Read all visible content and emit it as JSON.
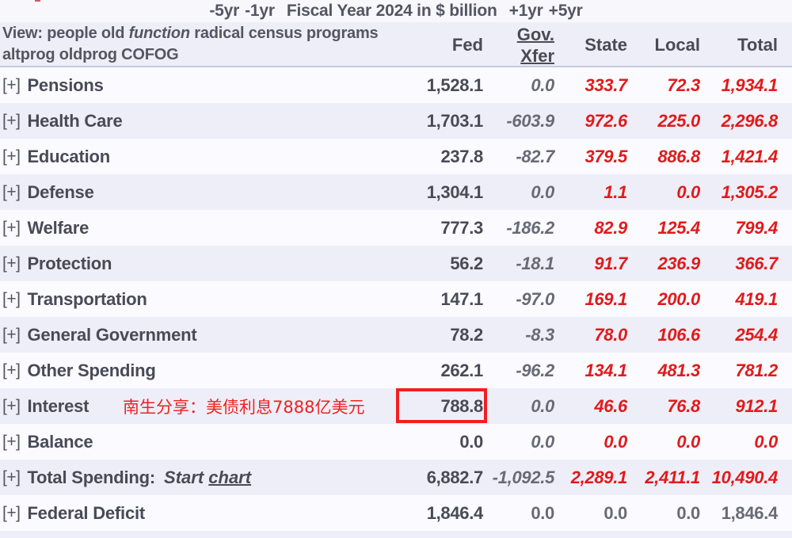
{
  "yearbar": {
    "back5": "-5yr",
    "back1": "-1yr",
    "title": "Fiscal Year 2024 in $ billion",
    "fwd1": "+1yr",
    "fwd5": "+5yr"
  },
  "view": {
    "label": "View:",
    "options": [
      "people",
      "old",
      "function",
      "radical",
      "census",
      "programs",
      "altprog",
      "oldprog",
      "COFOG"
    ],
    "selected": "function",
    "line1": "View: people old function radical census",
    "line2": "programs altprog oldprog COFOG"
  },
  "columns": [
    {
      "key": "fed",
      "label": "Fed",
      "label2": "",
      "underline": false
    },
    {
      "key": "xfer",
      "label": "Gov.",
      "label2": "Xfer",
      "underline": true
    },
    {
      "key": "state",
      "label": "State",
      "label2": "",
      "underline": false
    },
    {
      "key": "local",
      "label": "Local",
      "label2": "",
      "underline": false
    },
    {
      "key": "total",
      "label": "Total",
      "label2": "",
      "underline": false
    }
  ],
  "expander": "[+]",
  "rows": [
    {
      "name": "Pensions",
      "fed": "1,528.1",
      "xfer": "0.0",
      "state": "333.7",
      "local": "72.3",
      "total": "1,934.1",
      "style": "red"
    },
    {
      "name": "Health Care",
      "fed": "1,703.1",
      "xfer": "-603.9",
      "state": "972.6",
      "local": "225.0",
      "total": "2,296.8",
      "style": "red"
    },
    {
      "name": "Education",
      "fed": "237.8",
      "xfer": "-82.7",
      "state": "379.5",
      "local": "886.8",
      "total": "1,421.4",
      "style": "red"
    },
    {
      "name": "Defense",
      "fed": "1,304.1",
      "xfer": "0.0",
      "state": "1.1",
      "local": "0.0",
      "total": "1,305.2",
      "style": "red"
    },
    {
      "name": "Welfare",
      "fed": "777.3",
      "xfer": "-186.2",
      "state": "82.9",
      "local": "125.4",
      "total": "799.4",
      "style": "red"
    },
    {
      "name": "Protection",
      "fed": "56.2",
      "xfer": "-18.1",
      "state": "91.7",
      "local": "236.9",
      "total": "366.7",
      "style": "red"
    },
    {
      "name": "Transportation",
      "fed": "147.1",
      "xfer": "-97.0",
      "state": "169.1",
      "local": "200.0",
      "total": "419.1",
      "style": "red"
    },
    {
      "name": "General Government",
      "fed": "78.2",
      "xfer": "-8.3",
      "state": "78.0",
      "local": "106.6",
      "total": "254.4",
      "style": "red"
    },
    {
      "name": "Other Spending",
      "fed": "262.1",
      "xfer": "-96.2",
      "state": "134.1",
      "local": "481.3",
      "total": "781.2",
      "style": "red"
    },
    {
      "name": "Interest",
      "fed": "788.8",
      "xfer": "0.0",
      "state": "46.6",
      "local": "76.8",
      "total": "912.1",
      "style": "red"
    },
    {
      "name": "Balance",
      "fed": "0.0",
      "xfer": "0.0",
      "state": "0.0",
      "local": "0.0",
      "total": "0.0",
      "style": "red"
    },
    {
      "name": "Total Spending:",
      "fed": "6,882.7",
      "xfer": "-1,092.5",
      "state": "2,289.1",
      "local": "2,411.1",
      "total": "10,490.4",
      "style": "red"
    },
    {
      "name": "Federal Deficit",
      "fed": "1,846.4",
      "xfer": "0.0",
      "state": "0.0",
      "local": "0.0",
      "total": "1,846.4",
      "style": "gray"
    }
  ],
  "total_spending_link": {
    "prefix": "Start",
    "link": "chart"
  },
  "annotation": {
    "text": "南生分享：美债利息7888亿美元",
    "color": "#ee2222",
    "row": "Interest",
    "highlight_value": "788.8",
    "highlight_color": "#f02020"
  },
  "colors": {
    "red_value": "#e01b1b",
    "gray_value": "#6a6a76",
    "dark_text": "#4a4a57",
    "row_bg": "#fafaff",
    "row_alt_bg": "#eeeef8",
    "header_bg": "#eeeef8"
  }
}
